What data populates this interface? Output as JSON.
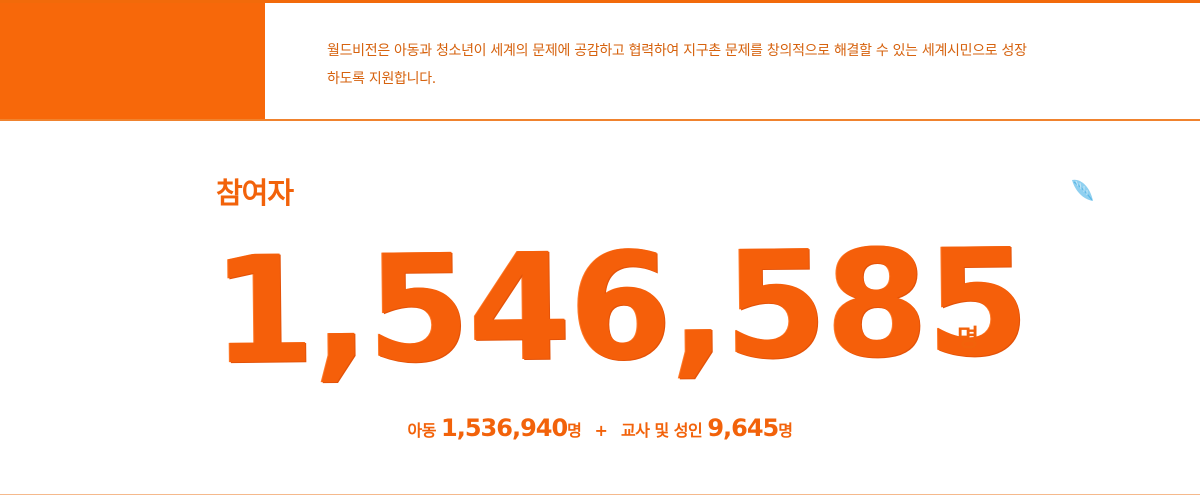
{
  "intro": {
    "line1": "월드비전은 아동과 청소년이 세계의 문제에 공감하고 협력하여 지구촌 문제를 창의적으로 해결할 수 있는 세계시민으로 성장",
    "line2": "하도록 지원합니다."
  },
  "participants": {
    "label": "참여자",
    "total": "1,546,585",
    "unit": "명",
    "children_label": "아동",
    "children_count": "1,536,940",
    "children_unit": "명",
    "plus": "+",
    "adults_label": "교사 및 성인",
    "adults_count": "9,645",
    "adults_unit": "명"
  },
  "decor": {
    "feather_icon": "feather-icon"
  },
  "colors": {
    "accent": "#f55f0a",
    "block": "#f7680a",
    "feather": "#8fd0f0"
  }
}
